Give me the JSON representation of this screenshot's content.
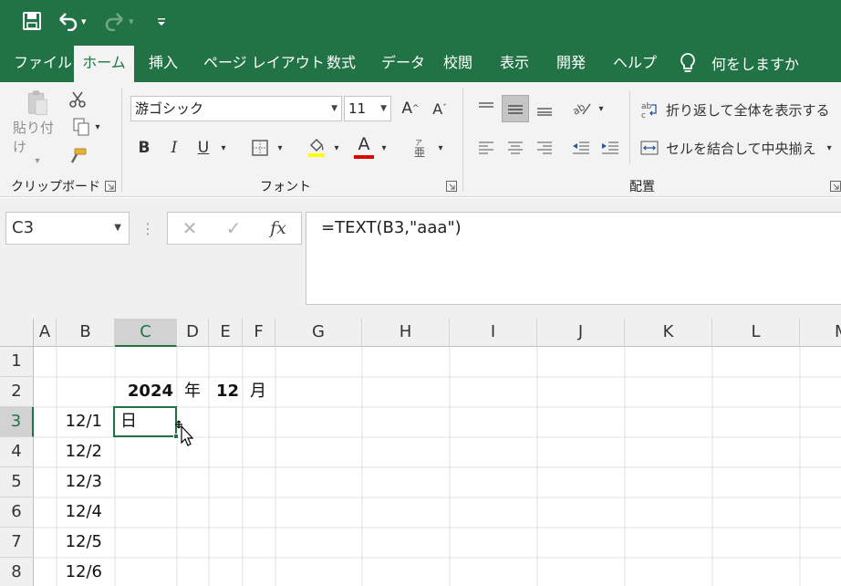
{
  "colors": {
    "excel_green": "#217346",
    "ribbon_bg": "#f3f3f3",
    "font_color_bar": "#e00000"
  },
  "qat": {
    "save_icon": "save-icon",
    "undo_icon": "undo-icon",
    "redo_icon": "redo-icon",
    "customize_icon": "customize-qat-icon"
  },
  "tabs": [
    {
      "label": "ファイル",
      "active": false
    },
    {
      "label": "ホーム",
      "active": true
    },
    {
      "label": "挿入",
      "active": false
    },
    {
      "label": "ページ レイアウト",
      "active": false
    },
    {
      "label": "数式",
      "active": false
    },
    {
      "label": "データ",
      "active": false
    },
    {
      "label": "校閲",
      "active": false
    },
    {
      "label": "表示",
      "active": false
    },
    {
      "label": "開発",
      "active": false
    },
    {
      "label": "ヘルプ",
      "active": false
    }
  ],
  "tell_me": {
    "label": "何をしますか",
    "icon": "lightbulb-icon"
  },
  "ribbon": {
    "clipboard": {
      "group_label": "クリップボード",
      "paste_label": "貼り付け"
    },
    "font": {
      "group_label": "フォント",
      "font_name": "游ゴシック",
      "font_size": "11",
      "bold": "B",
      "italic": "I",
      "underline": "U",
      "font_color_letter": "A"
    },
    "alignment": {
      "group_label": "配置",
      "wrap_text_label": "折り返して全体を表示する",
      "merge_center_label": "セルを結合して中央揃え"
    }
  },
  "formula_bar": {
    "name_box": "C3",
    "formula": "=TEXT(B3,\"aaa\")",
    "fx_label": "fx"
  },
  "grid": {
    "columns": [
      "A",
      "B",
      "C",
      "D",
      "E",
      "F",
      "G",
      "H",
      "I",
      "J",
      "K",
      "L",
      "M"
    ],
    "selected_column": "C",
    "rows": [
      "1",
      "2",
      "3",
      "4",
      "5",
      "6",
      "7",
      "8"
    ],
    "selected_row": "3",
    "cells": {
      "C2": "2024",
      "D2": "年",
      "E2": "12",
      "F2": "月",
      "B3": "12/1",
      "C3": "日",
      "B4": "12/2",
      "B5": "12/3",
      "B6": "12/4",
      "B7": "12/5",
      "B8": "12/6"
    },
    "active_cell": "C3"
  }
}
